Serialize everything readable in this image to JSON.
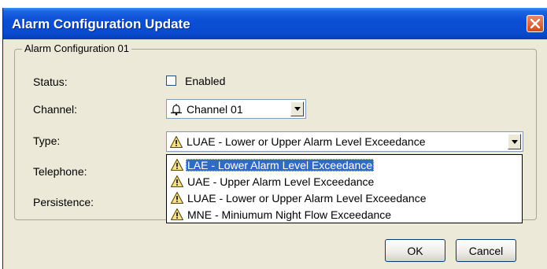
{
  "window": {
    "title": "Alarm Configuration Update"
  },
  "group": {
    "title": "Alarm Configuration 01"
  },
  "fields": {
    "status": {
      "label": "Status:",
      "checkbox_label": "Enabled",
      "checked": false
    },
    "channel": {
      "label": "Channel:",
      "value": "Channel 01"
    },
    "type": {
      "label": "Type:",
      "value": "LUAE - Lower or Upper Alarm Level Exceedance"
    },
    "telephone": {
      "label": "Telephone:"
    },
    "persistence": {
      "label": "Persistence:"
    }
  },
  "type_dropdown": {
    "options": [
      {
        "label": "LAE - Lower Alarm Level Exceedance",
        "selected": true,
        "icon": "warning-icon"
      },
      {
        "label": "UAE - Upper Alarm Level Exceedance",
        "selected": false,
        "icon": "warning-icon"
      },
      {
        "label": "LUAE - Lower or Upper Alarm Level Exceedance",
        "selected": false,
        "icon": "warning-icon"
      },
      {
        "label": "MNE - Miniumum Night Flow Exceedance",
        "selected": false,
        "icon": "warning-icon"
      }
    ]
  },
  "buttons": {
    "ok": "OK",
    "cancel": "Cancel"
  },
  "colors": {
    "titlebar": "#0b4fd6",
    "dialog_bg": "#ece9d8",
    "selection": "#316ac5",
    "close": "#d24b1c"
  }
}
